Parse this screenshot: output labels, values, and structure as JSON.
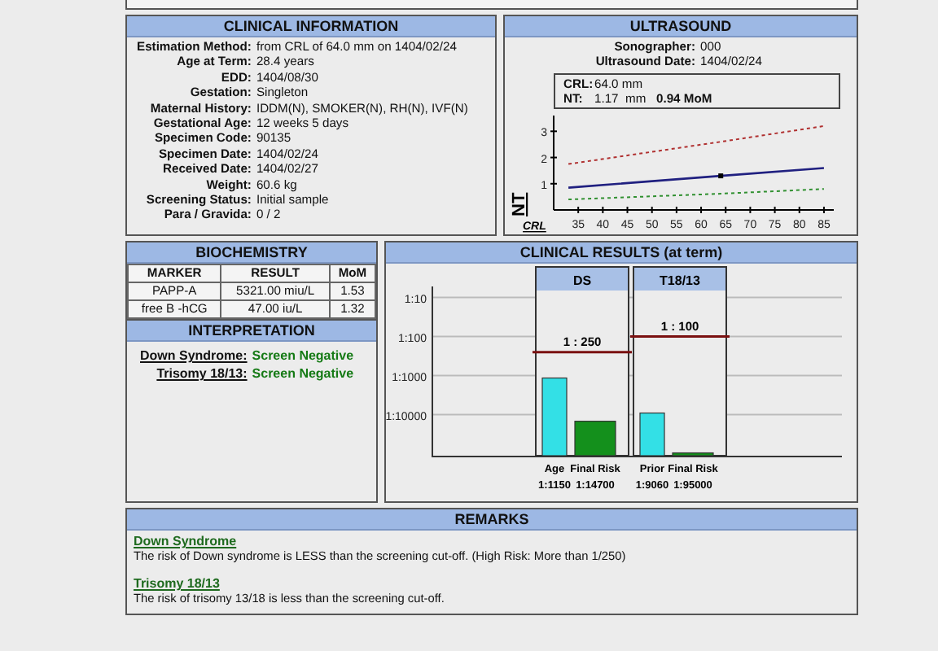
{
  "clinical_information": {
    "title": "CLINICAL INFORMATION",
    "fields": [
      {
        "label": "Estimation Method:",
        "value": "from CRL of 64.0 mm on 1404/02/24"
      },
      {
        "label": "Age at Term:",
        "value": "28.4 years"
      },
      {
        "label": "EDD:",
        "value": "1404/08/30"
      },
      {
        "label": "Gestation:",
        "value": "Singleton"
      },
      {
        "label": "Maternal History:",
        "value": "IDDM(N), SMOKER(N), RH(N), IVF(N)"
      },
      {
        "label": "Gestational Age:",
        "value": "12 weeks 5 days"
      },
      {
        "label": "Specimen Code:",
        "value": "90135"
      },
      {
        "label": "Specimen Date:",
        "value": "1404/02/24"
      },
      {
        "label": "Received Date:",
        "value": "1404/02/27"
      },
      {
        "label": "Weight:",
        "value": "60.6 kg"
      },
      {
        "label": "Screening Status:",
        "value": "Initial sample"
      },
      {
        "label": "Para / Gravida:",
        "value": "0 / 2"
      }
    ]
  },
  "ultrasound": {
    "title": "ULTRASOUND",
    "fields": [
      {
        "label": "Sonographer:",
        "value": "000"
      },
      {
        "label": "Ultrasound Date:",
        "value": "1404/02/24"
      }
    ],
    "measurements": [
      {
        "label": "CRL:",
        "value": "64.0 mm"
      },
      {
        "label": "NT:",
        "value": "1.17  mm   **0.94 MoM**"
      }
    ],
    "chart_data": {
      "type": "line",
      "xlabel": "CRL",
      "ylabel": "NT",
      "x": [
        33,
        64,
        85
      ],
      "xlim": [
        30,
        87
      ],
      "ylim": [
        0,
        3.6
      ],
      "xticks": [
        35,
        40,
        45,
        50,
        55,
        60,
        65,
        70,
        75,
        80,
        85
      ],
      "yticks": [
        1,
        2,
        3
      ],
      "series": [
        {
          "color": "#b03030",
          "line_style": "dotted",
          "values": [
            1.75,
            2.6,
            3.2
          ]
        },
        {
          "color": "#202080",
          "line_style": "solid",
          "values": [
            0.85,
            1.3,
            1.6
          ]
        },
        {
          "color": "#309030",
          "line_style": "dotted",
          "values": [
            0.4,
            0.62,
            0.8
          ]
        },
        {
          "color": "#000000",
          "line_style": "none",
          "marker": "square",
          "values": [
            null,
            1.3,
            null
          ]
        }
      ]
    }
  },
  "biochemistry": {
    "title": "BIOCHEMISTRY",
    "columns": [
      "MARKER",
      "RESULT",
      "MoM"
    ],
    "rows": [
      [
        "PAPP-A",
        "5321.00 miu/L",
        "1.53"
      ],
      [
        "free B -hCG",
        "47.00 iu/L",
        "1.32"
      ]
    ]
  },
  "interpretation": {
    "title": "INTERPRETATION",
    "items": [
      {
        "label": "Down Syndrome:",
        "value": "Screen Negative"
      },
      {
        "label": "Trisomy 18/13:",
        "value": "Screen Negative"
      }
    ]
  },
  "clinical_results": {
    "title": "CLINICAL RESULTS (at term)",
    "y_axis_labels": [
      "1:10",
      "1:100",
      "1:1000",
      "1:10000"
    ],
    "groups": [
      {
        "label": "DS",
        "cutoff_label": "1 : 250",
        "bars": [
          {
            "kind": "prior",
            "label": "Age",
            "risk": "1:1150"
          },
          {
            "kind": "final",
            "label": "Final Risk",
            "risk": "1:14700"
          }
        ]
      },
      {
        "label": "T18/13",
        "cutoff_label": "1 : 100",
        "bars": [
          {
            "kind": "prior",
            "label": "Prior",
            "risk": "1:9060"
          },
          {
            "kind": "final",
            "label": "Final Risk",
            "risk": "1:95000"
          }
        ]
      }
    ]
  },
  "remarks": {
    "title": "REMARKS",
    "items": [
      {
        "heading": "Down Syndrome",
        "text": "The risk of Down syndrome is LESS than the screening cut-off. (High Risk: More than 1/250)"
      },
      {
        "heading": "Trisomy 18/13",
        "text": "The risk of trisomy 13/18 is less than the screening cut-off."
      }
    ]
  }
}
